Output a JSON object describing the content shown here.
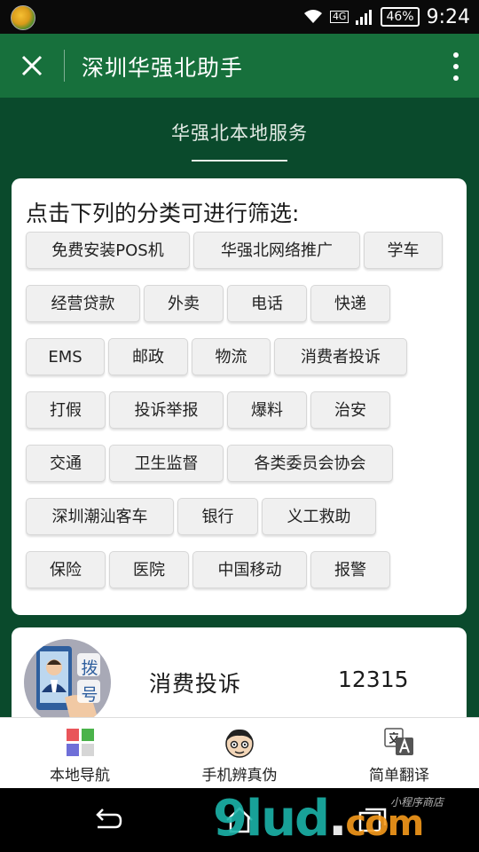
{
  "status_bar": {
    "network": "4G",
    "battery": "46%",
    "time": "9:24"
  },
  "app_bar": {
    "title": "深圳华强北助手"
  },
  "main": {
    "section_title": "华强北本地服务",
    "filter_card": {
      "heading": "点击下列的分类可进行筛选:",
      "tags": [
        "免费安装POS机",
        "华强北网络推广",
        "学车",
        "经营贷款",
        "外卖",
        "电话",
        "快递",
        "EMS",
        "邮政",
        "物流",
        "消费者投诉",
        "打假",
        "投诉举报",
        "爆料",
        "治安",
        "交通",
        "卫生监督",
        "各类委员会协会",
        "深圳潮汕客车",
        "银行",
        "义工救助",
        "保险",
        "医院",
        "中国移动",
        "报警"
      ]
    },
    "contact_card": {
      "avatar_text": "拨号",
      "label": "消费投诉",
      "number": "12315"
    }
  },
  "bottom_nav": {
    "items": [
      {
        "label": "本地导航",
        "icon": "grid-icon"
      },
      {
        "label": "手机辨真伪",
        "icon": "face-icon"
      },
      {
        "label": "简单翻译",
        "icon": "translate-icon"
      }
    ]
  },
  "watermark": {
    "brand": "9lud",
    "dot": ".",
    "tld": "com",
    "tagline": "小程序商店"
  },
  "colors": {
    "app_bar": "#17703c",
    "background": "#0a4a2c",
    "card": "#ffffff"
  }
}
